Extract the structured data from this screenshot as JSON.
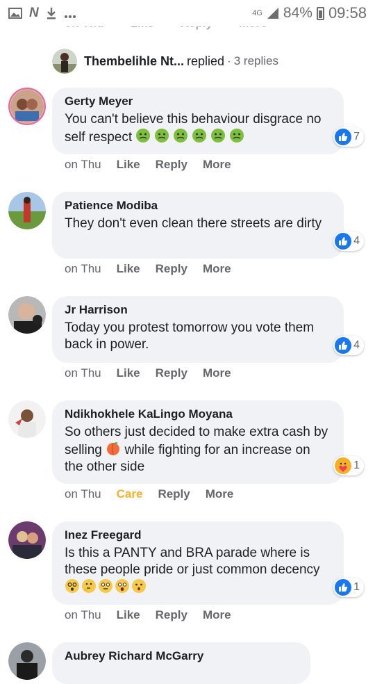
{
  "status_bar": {
    "network": "4G",
    "battery": "84%",
    "time": "09:58",
    "icons": [
      "image-icon",
      "n-icon",
      "download-icon",
      "more-dots-icon",
      "signal-icon",
      "battery-icon"
    ]
  },
  "cutoff_actions": [
    "on Thu",
    "Like",
    "Reply",
    "More"
  ],
  "replied_row": {
    "name": "Thembelihle Nt...",
    "verb": "replied",
    "separator": "·",
    "count": "3 replies"
  },
  "comments": [
    {
      "name": "Gerty Meyer",
      "text": "You can't believe this behaviour disgrace no self respect",
      "emoji": "nauseated-face x6",
      "reaction": "like",
      "reaction_count": "7",
      "time": "on Thu",
      "actions": [
        "Like",
        "Reply",
        "More"
      ]
    },
    {
      "name": "Patience Modiba",
      "text": "They don't even clean there streets are dirty",
      "reaction": "like",
      "reaction_count": "4",
      "time": "on Thu",
      "actions": [
        "Like",
        "Reply",
        "More"
      ]
    },
    {
      "name": "Jr Harrison",
      "text": "Today you protest tomorrow you vote them back in power.",
      "reaction": "like",
      "reaction_count": "4",
      "time": "on Thu",
      "actions": [
        "Like",
        "Reply",
        "More"
      ]
    },
    {
      "name": "Ndikhokhele KaLingo Moyana",
      "text_before": "So others just decided to make extra cash by selling",
      "text_after": "while fighting for an increase on the other side",
      "emoji": "peach",
      "reaction": "care",
      "reaction_count": "1",
      "time": "on Thu",
      "actions": [
        "Care",
        "Reply",
        "More"
      ]
    },
    {
      "name": "Inez Freegard",
      "text": "Is this a PANTY and BRA parade where is these people pride or just common decency",
      "emoji": "dizzy, thinking, flushed, astonished, hushed",
      "reaction": "like",
      "reaction_count": "1",
      "time": "on Thu",
      "actions": [
        "Like",
        "Reply",
        "More"
      ]
    },
    {
      "name": "Aubrey Richard McGarry"
    }
  ],
  "colors": {
    "bubble": "#f0f2f5",
    "like_blue": "#1877f2",
    "care_yellow": "#f7b125",
    "muted_text": "#65676b"
  }
}
